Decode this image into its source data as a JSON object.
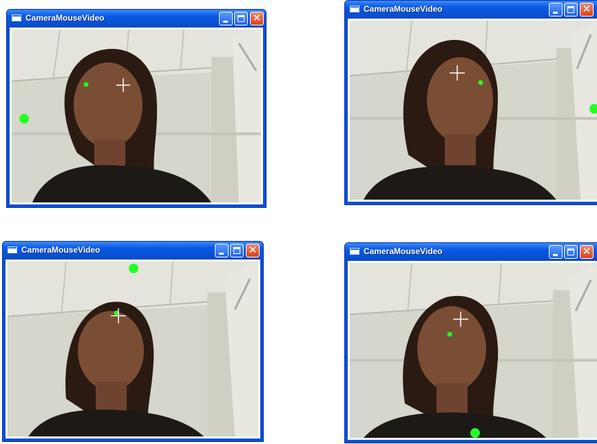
{
  "windows": [
    {
      "title": "CameraMouseVideo"
    },
    {
      "title": "CameraMouseVideo"
    },
    {
      "title": "CameraMouseVideo"
    },
    {
      "title": "CameraMouseVideo"
    }
  ],
  "controls": {
    "minimize": "minimize",
    "maximize": "maximize",
    "close": "close",
    "close_glyph": "✕"
  },
  "colors": {
    "titlebar": "#0a5ae6",
    "tracking_marker": "#22ff22",
    "feature_point": "#22ff22",
    "crosshair": "#ffffff",
    "close_button": "#d9421c"
  }
}
